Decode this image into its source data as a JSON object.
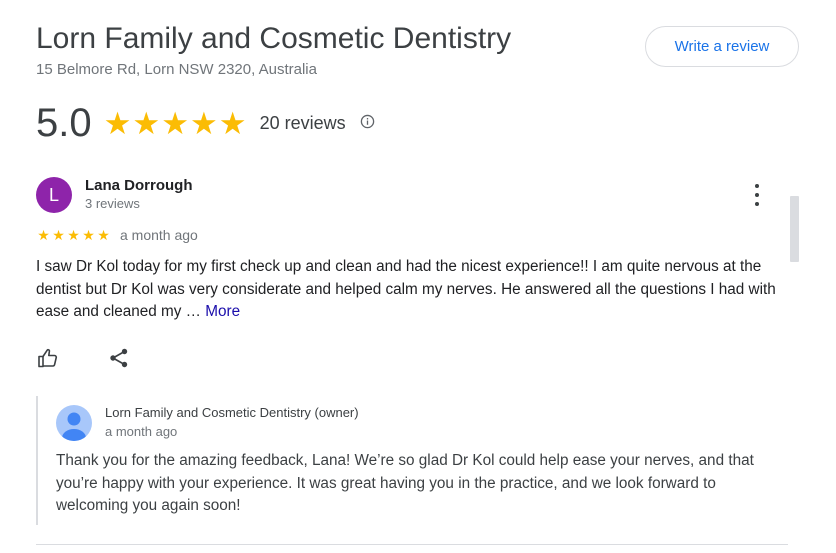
{
  "business": {
    "name": "Lorn Family and Cosmetic Dentistry",
    "address": "15 Belmore Rd, Lorn NSW 2320, Australia",
    "write_review_label": "Write a review",
    "rating": "5.0",
    "stars": 5,
    "review_count": "20 reviews"
  },
  "review": {
    "avatar_letter": "L",
    "avatar_color": "#8e24aa",
    "reviewer_name": "Lana Dorrough",
    "reviewer_meta": "3 reviews",
    "stars": 5,
    "time": "a month ago",
    "text": "I saw Dr Kol today for my first check up and clean and had the nicest experience!! I am quite nervous at the dentist but Dr Kol was very considerate and helped calm my nerves. He answered all the questions I had with ease and cleaned my …",
    "more_label": "More"
  },
  "owner_response": {
    "name": "Lorn Family and Cosmetic Dentistry (owner)",
    "time": "a month ago",
    "text": "Thank you for the amazing feedback, Lana! We’re so glad Dr Kol could help ease your nerves, and that you’re happy with your experience. It was great having you in the practice, and we look forward to welcoming you again soon!"
  },
  "icons": {
    "info": "info-icon",
    "more": "more-vertical-icon",
    "like": "thumbs-up-icon",
    "share": "share-icon",
    "owner_avatar": "person-avatar-icon"
  },
  "colors": {
    "star": "#fbbc04",
    "link_blue": "#1a73e8",
    "more_link": "#1a0dab"
  }
}
